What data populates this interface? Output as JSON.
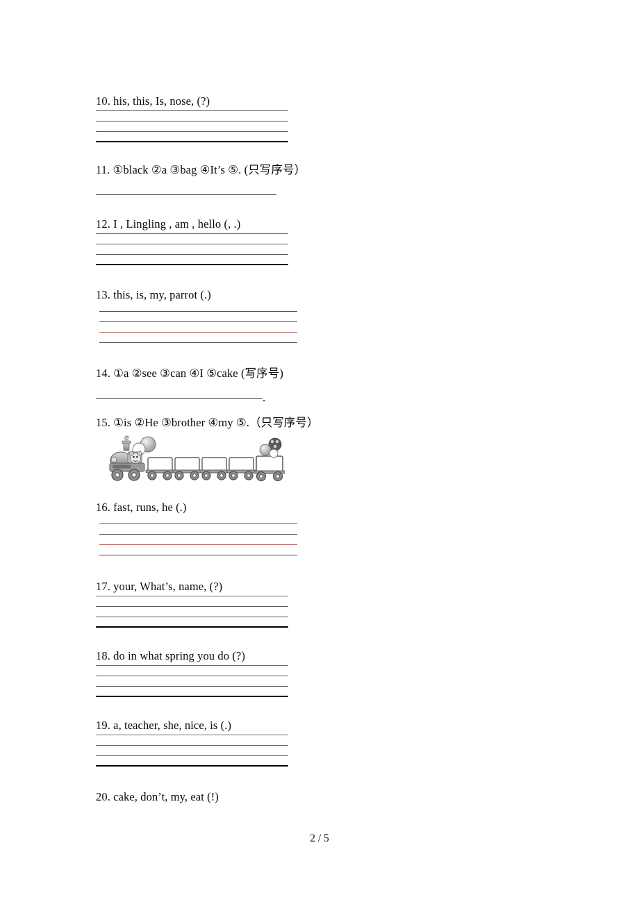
{
  "document": {
    "footer_page_label": "2 / 5"
  },
  "questions": [
    {
      "id": "q10",
      "number": "10.",
      "text": "10. his, this, Is, nose, (?)",
      "answer_style": "four-ruled-lines"
    },
    {
      "id": "q11",
      "number": "11.",
      "text": "11. ①black  ②a  ③bag  ④It’s ⑤. (只写序号）",
      "answer_style": "single-blank-line"
    },
    {
      "id": "q12",
      "number": "12.",
      "text": "12. I , Lingling , am , hello (, .)",
      "answer_style": "four-ruled-lines"
    },
    {
      "id": "q13",
      "number": "13.",
      "text": "13. this, is, my, parrot (.)",
      "answer_style": "four-ruled-lines-red"
    },
    {
      "id": "q14",
      "number": "14.",
      "text": "14. ①a  ②see  ③can  ④I ⑤cake (写序号)",
      "answer_style": "single-blank-line-period",
      "trailing_punctuation": "."
    },
    {
      "id": "q15",
      "number": "15.",
      "text": "15. ①is  ②He  ③brother  ④my  ⑤.（只写序号）",
      "answer_style": "train-illustration",
      "illustration": {
        "name": "train-illustration",
        "description": "cartoon steam locomotive with driver and balloons pulling five empty boxcars",
        "car_count": 5
      }
    },
    {
      "id": "q16",
      "number": "16.",
      "text": "16. fast,   runs,   he (.)",
      "answer_style": "four-ruled-lines-red"
    },
    {
      "id": "q17",
      "number": "17.",
      "text": "17. your, What’s, name, (?)",
      "answer_style": "four-ruled-lines"
    },
    {
      "id": "q18",
      "number": "18.",
      "text": "18. do  in  what  spring  you  do (?)",
      "answer_style": "four-ruled-lines"
    },
    {
      "id": "q19",
      "number": "19.",
      "text": "19. a, teacher, she, nice, is (.)",
      "answer_style": "four-ruled-lines"
    },
    {
      "id": "q20",
      "number": "20.",
      "text": "20. cake, don’t, my, eat (!)",
      "answer_style": "none"
    }
  ],
  "colors": {
    "rule_line_gray": "#5c5c66",
    "rule_line_bold": "#000000",
    "rule_line_red": "#f04438",
    "text": "#0a0a0a"
  }
}
